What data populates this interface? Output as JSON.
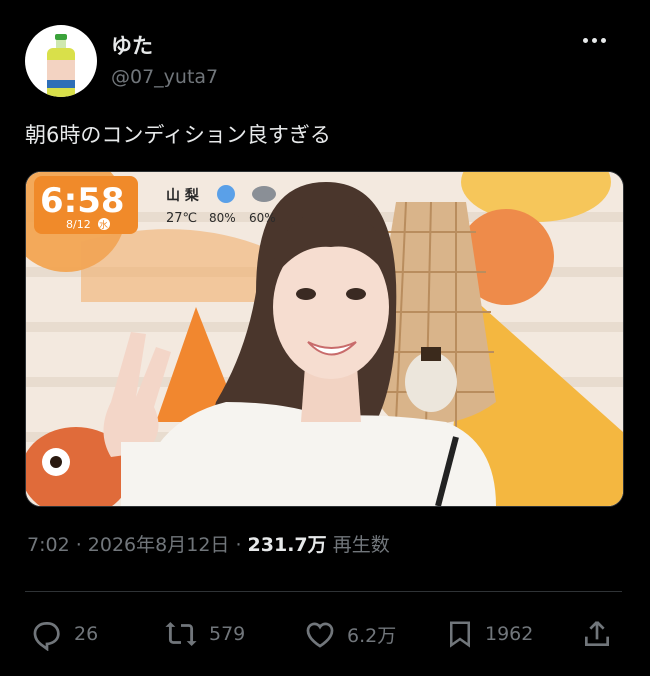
{
  "author": {
    "name": "ゆた",
    "handle": "@07_yuta7",
    "avatar_icon": "drink-bottle-avatar"
  },
  "tweet": {
    "text": "朝6時のコンディション良すぎる"
  },
  "media": {
    "overlay_time": "6:58",
    "overlay_date": "8/12",
    "overlay_day": "水",
    "overlay_region": "山 梨",
    "overlay_temp": "27℃",
    "overlay_pct1": "80%",
    "overlay_pct2": "60%"
  },
  "meta": {
    "time": "7:02",
    "sep": " · ",
    "date": "2026年8月12日",
    "views": "231.7万",
    "views_label": "再生数"
  },
  "actions": {
    "reply": {
      "icon": "reply-icon",
      "count": "26"
    },
    "retweet": {
      "icon": "retweet-icon",
      "count": "579"
    },
    "like": {
      "icon": "heart-icon",
      "count": "6.2万"
    },
    "bookmark": {
      "icon": "bookmark-icon",
      "count": "1962"
    },
    "share": {
      "icon": "share-icon"
    }
  },
  "colors": {
    "background": "#000000",
    "text": "#e7e9ea",
    "muted": "#71767b",
    "divider": "#2f3336"
  }
}
